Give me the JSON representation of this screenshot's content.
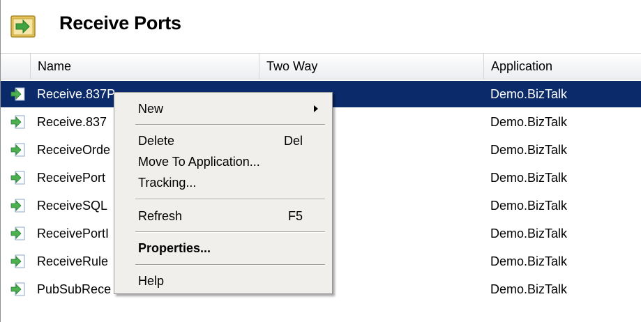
{
  "header": {
    "title": "Receive Ports",
    "icon": "receive-ports-folder-icon"
  },
  "columns": {
    "name": "Name",
    "two_way": "Two Way",
    "application": "Application"
  },
  "rows": [
    {
      "name": "Receive.837P",
      "application": "Demo.BizTalk",
      "selected": true
    },
    {
      "name": "Receive.837",
      "application": "Demo.BizTalk"
    },
    {
      "name": "ReceiveOrde",
      "application": "Demo.BizTalk"
    },
    {
      "name": "ReceivePort",
      "application": "Demo.BizTalk"
    },
    {
      "name": "ReceiveSQL",
      "application": "Demo.BizTalk"
    },
    {
      "name": "ReceivePortI",
      "application": "Demo.BizTalk"
    },
    {
      "name": "ReceiveRule",
      "application": "Demo.BizTalk"
    },
    {
      "name": "PubSubRece",
      "application": "Demo.BizTalk"
    }
  ],
  "context_menu": {
    "new": "New",
    "delete": "Delete",
    "delete_shortcut": "Del",
    "move_to_application": "Move To Application...",
    "tracking": "Tracking...",
    "refresh": "Refresh",
    "refresh_shortcut": "F5",
    "properties": "Properties...",
    "help": "Help"
  },
  "colors": {
    "selection": "#0a2a69",
    "menu_background": "#f0efeb"
  }
}
